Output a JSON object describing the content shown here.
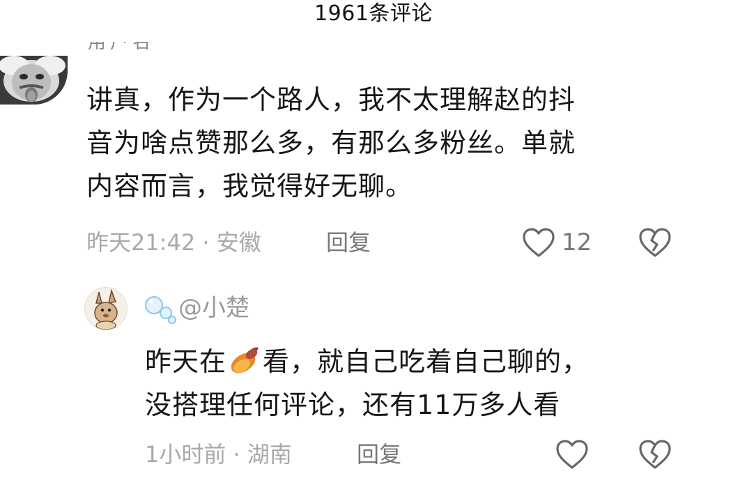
{
  "header": {
    "title": "1961条评论"
  },
  "comment": {
    "username_partial": "用户名",
    "text": "讲真，作为一个路人，我不太理解赵的抖音为啥点赞那么多，有那么多粉丝。单就内容而言，我觉得好无聊。",
    "lines": [
      "讲真，作为一个路人，我不太理解赵的抖",
      "音为啥点赞那么多，有那么多粉丝。单就",
      "内容而言，我觉得好无聊。"
    ],
    "time": "昨天21:42",
    "separator": "·",
    "location": "安徽",
    "reply_label": "回复",
    "like_count": "12",
    "icons": {
      "like": "heart-outline-icon",
      "dislike": "broken-heart-icon"
    }
  },
  "reply": {
    "username": "@小楚",
    "line1_before": "昨天在",
    "line1_after": "看，就自己吃着自己聊的，",
    "line2": "没搭理任何评论，还有11万多人看",
    "inline_emoji": "sweet-potato-icon",
    "time": "1小时前",
    "separator": "·",
    "location": "湖南",
    "reply_label": "回复",
    "icons": {
      "like": "heart-outline-icon",
      "dislike": "broken-heart-icon"
    }
  },
  "colors": {
    "text_primary": "#161616",
    "text_meta": "#a9a9a9",
    "text_action": "#777777",
    "icon_stroke": "#666666"
  }
}
